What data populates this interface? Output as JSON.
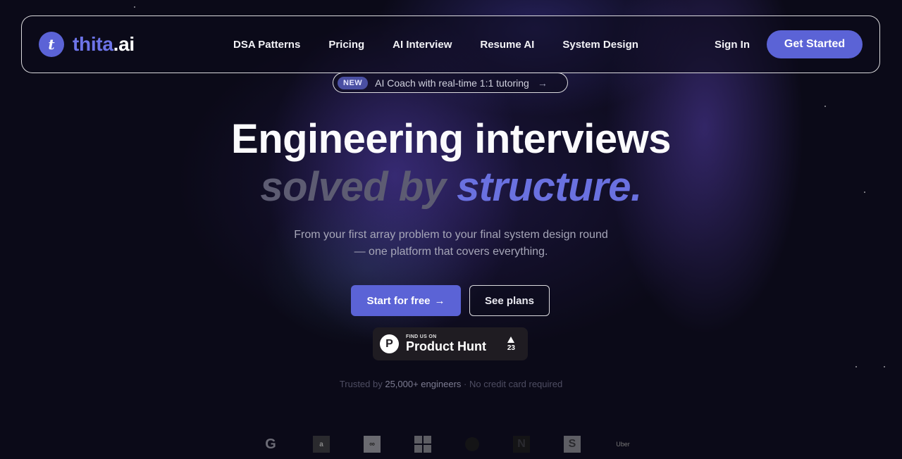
{
  "nav": {
    "logo_prefix": "thita",
    "logo_suffix": ".ai",
    "logo_mark": "t",
    "links": [
      "DSA Patterns",
      "Pricing",
      "AI Interview",
      "Resume AI",
      "System Design"
    ],
    "sign_in": "Sign In",
    "get_started": "Get Started"
  },
  "badge": {
    "tag": "NEW",
    "text": "AI Coach with real-time 1:1 tutoring",
    "arrow": "→"
  },
  "hero": {
    "line1": "Engineering interviews",
    "line2_muted": "solved by ",
    "line2_accent": "structure.",
    "sub_line1": "From your first array problem to your final system design round",
    "sub_line2": "— one platform that covers everything."
  },
  "cta": {
    "primary": "Start for free",
    "primary_arrow": "→",
    "secondary": "See plans"
  },
  "product_hunt": {
    "logo": "P",
    "small": "FIND US ON",
    "big": "Product Hunt",
    "votes": "23"
  },
  "trust": {
    "prefix": "Trusted by ",
    "count": "25,000+ engineers",
    "suffix": " · No credit card required"
  },
  "companies": {
    "google": "G",
    "amazon": "a",
    "meta": "∞",
    "netflix": "N",
    "stripe": "S",
    "uber": "Uber"
  },
  "colors": {
    "accent": "#5b63d6",
    "background": "#0b0a18"
  }
}
